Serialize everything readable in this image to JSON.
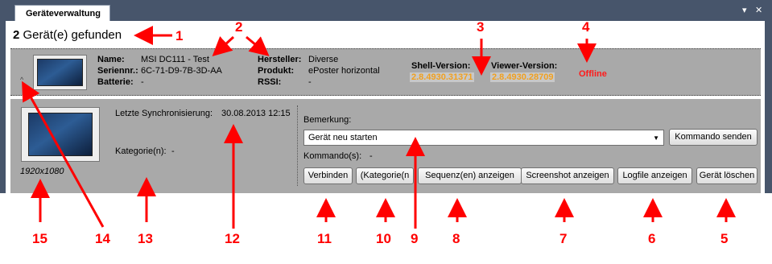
{
  "window": {
    "tab_title": "Geräteverwaltung",
    "pin_icon": "▾",
    "close_icon": "✕"
  },
  "found": {
    "count": "2",
    "text": "Gerät(e) gefunden"
  },
  "device": {
    "name_label": "Name:",
    "name": "MSI  DC111 - Test",
    "serial_label": "Seriennr.:",
    "serial": "6C-71-D9-7B-3D-AA",
    "battery_label": "Batterie:",
    "battery": "-",
    "manufacturer_label": "Hersteller:",
    "manufacturer": "Diverse",
    "product_label": "Produkt:",
    "product": "ePoster horizontal",
    "rssi_label": "RSSI:",
    "rssi": "-",
    "shell_version_label": "Shell-Version:",
    "shell_version": "2.8.4930.31371",
    "viewer_version_label": "Viewer-Version:",
    "viewer_version": "2.8.4930.28709",
    "status": "Offline",
    "collapse_icon": "^"
  },
  "detail": {
    "resolution": "1920x1080",
    "last_sync_label": "Letzte Synchronisierung:",
    "last_sync": "30.08.2013 12:15",
    "categories_label": "Kategorie(n):",
    "categories": "-",
    "remark_label": "Bemerkung:",
    "command_selected": "Gerät neu starten",
    "send_command_label": "Kommando senden",
    "commands_label": "Kommando(s):",
    "commands": "-",
    "buttons": {
      "connect": "Verbinden",
      "categories": "(Kategorie(n",
      "sequences": "Sequenz(en) anzeigen",
      "screenshot": "Screenshot anzeigen",
      "logfile": "Logfile anzeigen",
      "delete": "Gerät löschen"
    }
  },
  "annotations": {
    "n1": "1",
    "n2": "2",
    "n3": "3",
    "n4": "4",
    "n5": "5",
    "n6": "6",
    "n7": "7",
    "n8": "8",
    "n9": "9",
    "n10": "10",
    "n11": "11",
    "n12": "12",
    "n13": "13",
    "n14": "14",
    "n15": "15"
  },
  "colors": {
    "frame": "#47556b",
    "panel": "#a9a9a9",
    "version": "#f0a020",
    "offline": "#ff1a1a",
    "annotation": "#ff0000"
  }
}
